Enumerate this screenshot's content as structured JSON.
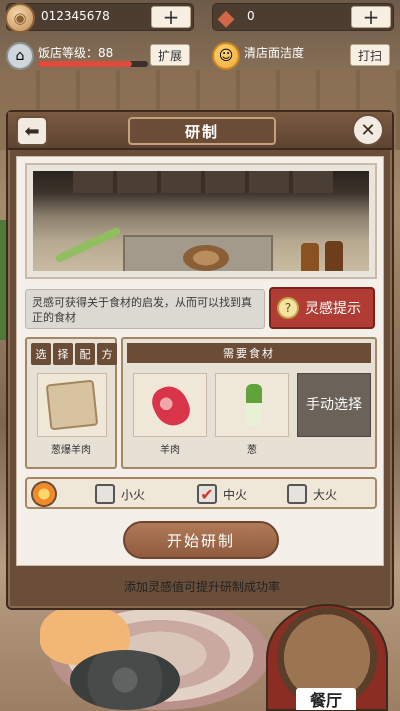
{
  "top": {
    "coins": "012345678",
    "gems": "0",
    "plus": "+",
    "shop_level_label": "饭店等级：88",
    "shop_level_progress": 0.85,
    "expand_btn": "扩展",
    "cleanliness_label": "清店面洁度",
    "clean_btn": "打扫"
  },
  "dialog": {
    "title": "研制",
    "back_icon": "back-arrow-icon",
    "close_icon": "close-icon",
    "hint_text": "灵感可获得关于食材的启发，从而可以找到真正的食材",
    "hint_btn": "灵感提示",
    "select_tabs": [
      "选",
      "择",
      "配",
      "方"
    ],
    "recipe_name": "葱爆羊肉",
    "need_header": "需要食材",
    "ingredients": [
      {
        "name": "羊肉",
        "icon": "meat-icon"
      },
      {
        "name": "葱",
        "icon": "scallion-icon"
      }
    ],
    "manual_select": "手动选择",
    "heat_options": [
      {
        "label": "小火",
        "checked": false
      },
      {
        "label": "中火",
        "checked": true
      },
      {
        "label": "大火",
        "checked": false
      }
    ],
    "start_btn": "开始研制",
    "tip": "添加灵感值可提升研制成功率"
  },
  "dining": {
    "label": "餐厅"
  },
  "colors": {
    "accent_red": "#b13c33",
    "panel_brown": "#6b4c36",
    "button_brown": "#9b6a4a"
  }
}
